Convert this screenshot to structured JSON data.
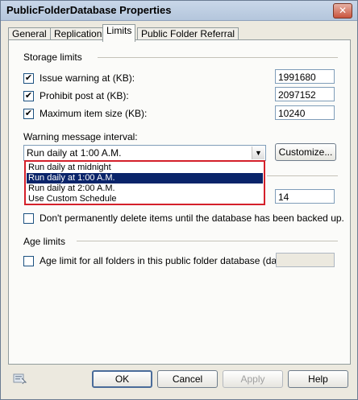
{
  "window": {
    "title": "PublicFolderDatabase Properties",
    "close_glyph": "✕"
  },
  "tabs": [
    {
      "label": "General"
    },
    {
      "label": "Replication"
    },
    {
      "label": "Limits",
      "active": true
    },
    {
      "label": "Public Folder Referral"
    }
  ],
  "storage": {
    "heading": "Storage limits",
    "issue_warning": {
      "label": "Issue warning at (KB):",
      "checked": true,
      "value": "1991680"
    },
    "prohibit_post": {
      "label": "Prohibit post at (KB):",
      "checked": true,
      "value": "2097152"
    },
    "max_item": {
      "label": "Maximum item size (KB):",
      "checked": true,
      "value": "10240"
    },
    "check_glyph": "✔"
  },
  "warning_interval": {
    "label": "Warning message interval:",
    "selected": "Run daily at 1:00 A.M.",
    "customize_label": "Customize...",
    "options": [
      {
        "label": "Run daily at midnight"
      },
      {
        "label": "Run daily at 1:00 A.M.",
        "selected": true
      },
      {
        "label": "Run daily at 2:00 A.M."
      },
      {
        "label": "Use Custom Schedule"
      }
    ]
  },
  "deletion": {
    "retention_value": "14",
    "dont_delete_label": "Don't permanently delete items until the database has been backed up.",
    "dont_delete_checked": false
  },
  "age": {
    "heading": "Age limits",
    "age_limit_label": "Age limit for all folders in this public folder database (days):",
    "age_limit_checked": false,
    "age_limit_value": ""
  },
  "buttons": {
    "ok": "OK",
    "cancel": "Cancel",
    "apply": "Apply",
    "help": "Help"
  },
  "colors": {
    "selection": "#0a246a",
    "highlight_border": "#d4202a",
    "panel": "#fbfbf9",
    "dialog": "#ece9df"
  }
}
